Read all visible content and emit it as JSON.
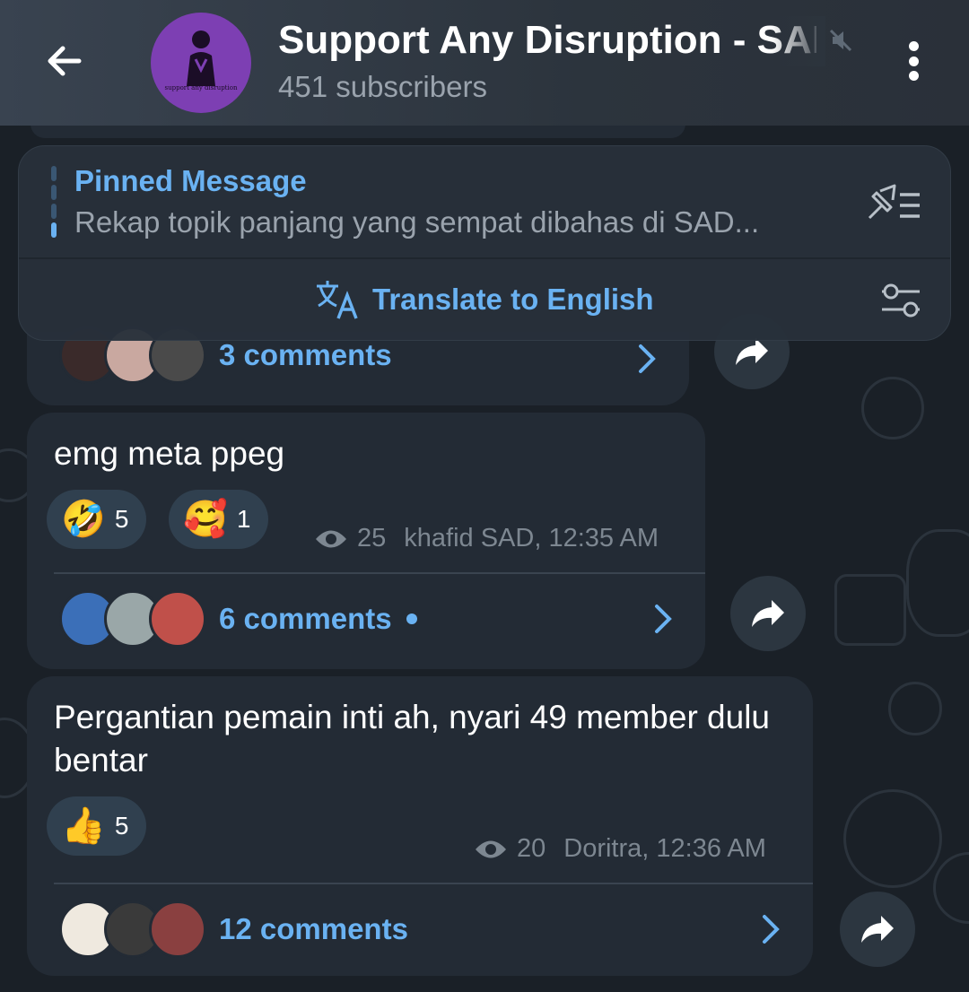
{
  "header": {
    "title": "Support Any Disruption - SAD",
    "subtitle": "451 subscribers",
    "avatar_caption": "support any disruption"
  },
  "pinned": {
    "title": "Pinned Message",
    "text": "Rekap topik panjang yang sempat dibahas di SAD...",
    "translate_label": "Translate to English"
  },
  "messages": [
    {
      "comments_label": "3 comments"
    },
    {
      "text": "emg meta ppeg",
      "reactions": [
        {
          "emoji": "🤣",
          "count": "5"
        },
        {
          "emoji": "🥰",
          "count": "1"
        }
      ],
      "views": "25",
      "author_time": "khafid SAD, 12:35 AM",
      "comments_label": "6 comments"
    },
    {
      "text": "Pergantian pemain inti ah, nyari 49 member dulu bentar",
      "reactions": [
        {
          "emoji": "👍",
          "count": "5"
        }
      ],
      "views": "20",
      "author_time": "Doritra, 12:36 AM",
      "comments_label": "12 comments"
    }
  ],
  "colors": {
    "accent": "#6ab2f2",
    "bubble": "#232b35",
    "background": "#1a2027",
    "avatar": "#7d3fb3"
  },
  "icons": [
    "arrow-left-icon",
    "mute-icon",
    "more-vertical-icon",
    "pin-list-icon",
    "translate-icon",
    "settings-sliders-icon",
    "eye-icon",
    "chevron-right-icon",
    "share-icon"
  ]
}
